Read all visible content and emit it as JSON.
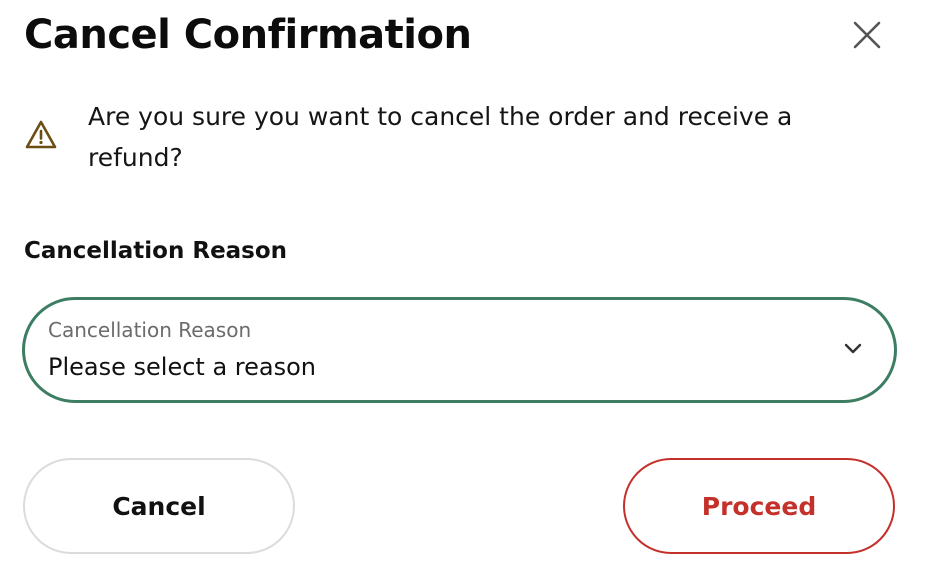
{
  "dialog": {
    "title": "Cancel Confirmation",
    "close_icon": "close-icon",
    "warning": {
      "icon": "warning-triangle-icon",
      "text": "Are you sure you want to cancel the order and receive a refund?"
    },
    "reason_section": {
      "label": "Cancellation Reason",
      "select": {
        "floating_label": "Cancellation Reason",
        "value": "Please select a reason",
        "icon": "chevron-down-icon"
      }
    },
    "buttons": {
      "cancel_label": "Cancel",
      "proceed_label": "Proceed"
    }
  },
  "colors": {
    "field_border": "#3d7e63",
    "proceed_accent": "#c4312b",
    "warning_icon": "#6b4e12",
    "secondary_text": "#6b6b6b"
  }
}
